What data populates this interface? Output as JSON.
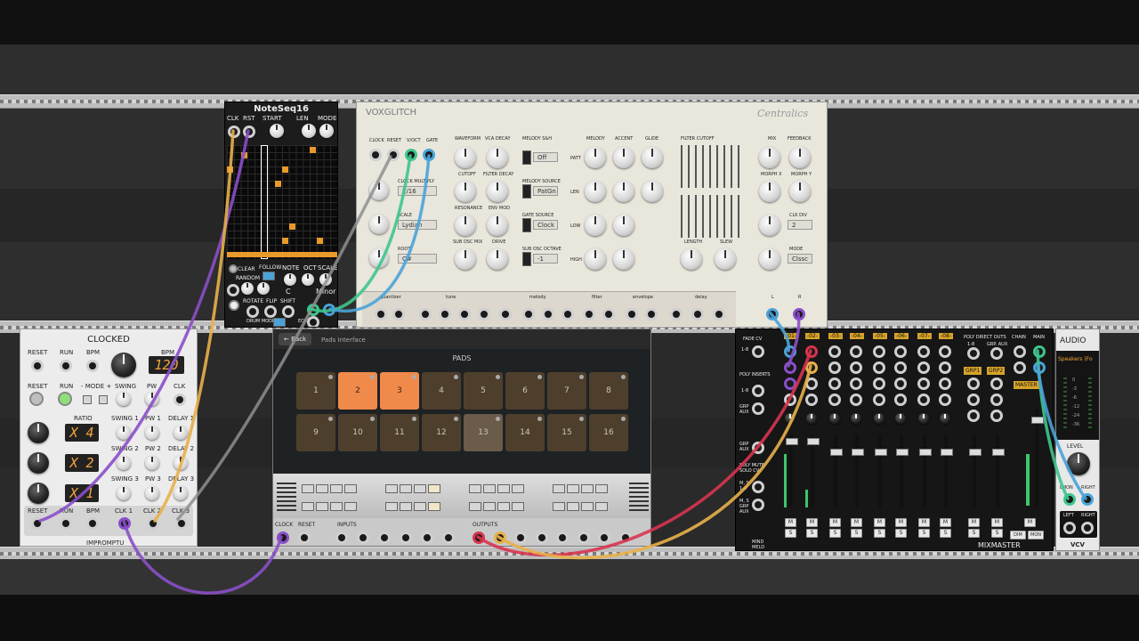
{
  "noteseq": {
    "title": "NoteSeq16",
    "top_labels": [
      "CLK",
      "RST",
      "START",
      "LEN",
      "MODE"
    ],
    "bottom_labels": [
      "CLEAR",
      "FOLLOW",
      "NOTE",
      "OCT",
      "SCALE",
      "RANDOM",
      "ROTATE",
      "FLIP",
      "SHIFT",
      "DRUM MODE",
      "EOC"
    ],
    "note_value": "C",
    "scale_value": "Minor"
  },
  "voxglitch": {
    "brand": "VOXGLITCH",
    "title": "Centralics",
    "inputs": [
      "CLOCK",
      "RESET",
      "V/OCT",
      "GATE"
    ],
    "col2": [
      "WAVEFORM",
      "VCA DECAY",
      "CUTOFF",
      "FILTER DECAY",
      "RESONANCE",
      "ENV MOD",
      "SUB OSC MIX",
      "DRIVE"
    ],
    "clock_multiply_label": "CLOCK MULTIPLY",
    "clock_multiply_value": "1/16",
    "scale_label": "SCALE",
    "scale_value": "Lydian",
    "root_label": "ROOT",
    "root_value": "C#",
    "melody_sh_label": "MELODY S&H",
    "melody_sh_value": "Off",
    "melody_source_label": "MELODY SOURCE",
    "melody_source_value": "PatGn",
    "gate_source_label": "GATE SOURCE",
    "gate_source_value": "Clock",
    "sub_osc_octave_label": "SUB OSC OCTAVE",
    "sub_osc_octave_value": "-1",
    "melody_cols": [
      "MELODY",
      "ACCENT",
      "GLIDE"
    ],
    "melody_rows": [
      "PATT",
      "LEN",
      "LOW",
      "HIGH"
    ],
    "filter_cutoff_label": "FILTER CUTOFF",
    "length_label": "LENGTH",
    "slew_label": "SLEW",
    "mix_label": "MIX",
    "feedback_label": "FEEDBACK",
    "morph_x_label": "MORPH X",
    "morph_y_label": "MORPH Y",
    "clk_div_label": "CLK DIV",
    "clk_div_value": "2",
    "mode_label": "MODE",
    "mode_value": "Clssc",
    "section_labels": [
      "quantizer",
      "tune",
      "melody",
      "filter",
      "envelope",
      "delay"
    ],
    "output_labels": [
      "L",
      "R"
    ]
  },
  "clocked": {
    "title": "CLOCKED",
    "bpm_value": "120",
    "ratio_values": [
      "X 4",
      "X 2",
      "X 1"
    ],
    "labels": [
      "RESET",
      "RUN",
      "BPM",
      "BPM",
      "RESET",
      "RUN",
      "- MODE +",
      "SWING",
      "PW",
      "CLK",
      "RATIO",
      "SWING 1",
      "PW 1",
      "DELAY 1",
      "SWING 2",
      "PW 2",
      "DELAY 2",
      "SWING 3",
      "PW 3",
      "DELAY 3"
    ],
    "bottom_labels": [
      "RESET",
      "RUN",
      "BPM",
      "CLK 1",
      "CLK 2",
      "CLK 3"
    ],
    "brand": "IMPROMPTU"
  },
  "pads": {
    "back": "← Back",
    "crumb": "Pads Interface",
    "title": "PADS",
    "pads": [
      "1",
      "2",
      "3",
      "4",
      "5",
      "6",
      "7",
      "8",
      "9",
      "10",
      "11",
      "12",
      "13",
      "14",
      "15",
      "16"
    ],
    "active": [
      2,
      3
    ],
    "hover": [
      13
    ],
    "active_color": "#f08a4b",
    "labels": [
      "CLOCK",
      "RESET",
      "INPUTS",
      "OUTPUTS"
    ]
  },
  "mixmaster": {
    "left_labels": [
      "FADE CV",
      "1-8",
      "POLY INSERTS",
      "1-8",
      "Grp Aux",
      "Grp Aux",
      "POLY MUTE SOLO CV",
      "M, S 1-8",
      "M, S Grp Aux"
    ],
    "channels": [
      "-01-",
      "-02-",
      "-03-",
      "-04-",
      "-05-",
      "-06-",
      "-07-",
      "-08-"
    ],
    "direct_outs_label": "POLY DIRECT OUTS",
    "direct_sub": [
      "1-8",
      "Grp. Aux"
    ],
    "groups": [
      "GRP1",
      "GRP2"
    ],
    "chain_label": "CHAIN",
    "main_label": "MAIN",
    "master_label": "MASTER",
    "m_label": "M",
    "s_label": "S",
    "dim_label": "DIM",
    "mon_label": "MON",
    "brand": "MIXMASTER",
    "maker": "MIND MELD"
  },
  "audio": {
    "title": "AUDIO",
    "device": "Speakers (Fo",
    "meter_labels": [
      "0",
      "-3",
      "-6",
      "-12",
      "-24",
      "-36"
    ],
    "level_label": "LEVEL",
    "in_labels": [
      "LMON",
      "RIGHT"
    ],
    "out_labels": [
      "LEFT",
      "RIGHT"
    ],
    "brand": "VCV"
  },
  "colors": {
    "cable_yellow": "#e8b04a",
    "cable_purple": "#8a4fc9",
    "cable_green": "#3fc58c",
    "cable_blue": "#4aa3d8",
    "cable_red": "#d8344f",
    "cable_gray": "#8e8e8e"
  }
}
